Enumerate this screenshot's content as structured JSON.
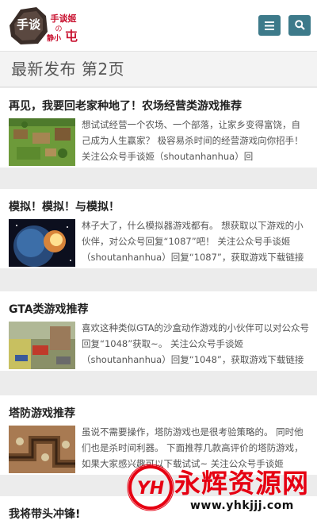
{
  "brand": {
    "logo_text_left": "手谈",
    "logo_text_right": "手谈姬の静小屯",
    "accent": "#3d7a8a"
  },
  "header": {
    "menu_icon": "hamburger-menu-icon",
    "search_icon": "search-icon"
  },
  "page": {
    "title": "最新发布 第2页"
  },
  "posts": [
    {
      "title": "再见，我要回老家种地了！农场经营类游戏推荐",
      "excerpt": "想试试经营一个农场、一个部落，让家乡变得富饶，自己成为人生赢家？ 极容易杀时间的经营游戏向你招手！ 关注公众号手谈姬（shoutanhanhua）回"
    },
    {
      "title": "模拟！模拟！与模拟！",
      "excerpt": "林子大了，什么模拟器游戏都有。 想获取以下游戏的小伙伴，对公众号回复“1087”吧！ 关注公众号手谈姬（shoutanhanhua）回复“1087”，获取游戏下载链接 密"
    },
    {
      "title": "GTA类游戏推荐",
      "excerpt": "喜欢这种类似GTA的沙盒动作游戏的小伙伴可以对公众号回复“1048”获取~。 关注公众号手谈姬（shoutanhanhua）回复“1048”，获取游戏下载链接 开"
    },
    {
      "title": "塔防游戏推荐",
      "excerpt": "虽说不需要操作，塔防游戏也是很考验策略的。 同时他们也是杀时间利器。 下面推荐几款高评价的塔防游戏，如果大家感兴趣可以下载试试~ 关注公众号手谈姬"
    },
    {
      "title": "我将带头冲锋!",
      "excerpt": ""
    }
  ],
  "watermark": {
    "logo": "YH",
    "text": "永辉资源网",
    "url": "www.yhkjjj.com"
  }
}
